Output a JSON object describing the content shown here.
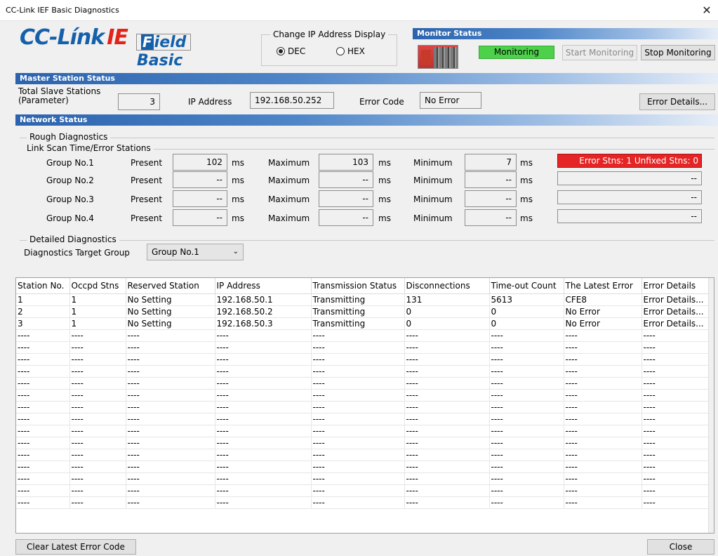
{
  "window": {
    "title": "CC-Link IEF Basic Diagnostics",
    "close_glyph": "✕"
  },
  "logo": {
    "cc": "CC-Línk",
    "ie": "IE",
    "field_initial": "F",
    "field_rest": "ield",
    "basic": "Basic"
  },
  "ip_display": {
    "legend": "Change IP Address Display",
    "dec_label": "DEC",
    "hex_label": "HEX",
    "selected": "DEC"
  },
  "monitor": {
    "header": "Monitor Status",
    "status": "Monitoring",
    "start_label": "Start Monitoring",
    "stop_label": "Stop Monitoring",
    "status_color": "#4dd14a"
  },
  "master": {
    "header": "Master Station Status",
    "total_slave_label_1": "Total Slave Stations",
    "total_slave_label_2": "(Parameter)",
    "total_slave_value": "3",
    "ip_label": "IP Address",
    "ip_value": "192.168.50.252",
    "error_code_label": "Error Code",
    "error_code_value": "No Error",
    "error_details_label": "Error Details..."
  },
  "network": {
    "header": "Network Status",
    "rough_title": "Rough Diagnostics",
    "link_scan_title": "Link Scan Time/Error Stations",
    "present_label": "Present",
    "maximum_label": "Maximum",
    "minimum_label": "Minimum",
    "unit": "ms",
    "groups": [
      {
        "name": "Group No.1",
        "present": "102",
        "maximum": "103",
        "minimum": "7",
        "error_text": "Error Stns: 1  Unfixed Stns: 0"
      },
      {
        "name": "Group No.2",
        "present": "--",
        "maximum": "--",
        "minimum": "--",
        "error_text": "--"
      },
      {
        "name": "Group No.3",
        "present": "--",
        "maximum": "--",
        "minimum": "--",
        "error_text": "--"
      },
      {
        "name": "Group No.4",
        "present": "--",
        "maximum": "--",
        "minimum": "--",
        "error_text": "--"
      }
    ],
    "detailed_title": "Detailed Diagnostics",
    "target_group_label": "Diagnostics Target Group",
    "target_group_value": "Group No.1",
    "error_color": "#e52525"
  },
  "table": {
    "columns": [
      "Station No.",
      "Occpd Stns",
      "Reserved Station",
      "IP Address",
      "Transmission Status",
      "Disconnections",
      "Time-out Count",
      "The Latest Error",
      "Error Details"
    ],
    "rows": [
      [
        "1",
        "1",
        "No Setting",
        "192.168.50.1",
        "Transmitting",
        "131",
        "5613",
        "CFE8",
        "Error Details..."
      ],
      [
        "2",
        "1",
        "No Setting",
        "192.168.50.2",
        "Transmitting",
        "0",
        "0",
        "No Error",
        "Error Details..."
      ],
      [
        "3",
        "1",
        "No Setting",
        "192.168.50.3",
        "Transmitting",
        "0",
        "0",
        "No Error",
        "Error Details..."
      ],
      [
        "----",
        "----",
        "----",
        "----",
        "----",
        "----",
        "----",
        "----",
        "----"
      ],
      [
        "----",
        "----",
        "----",
        "----",
        "----",
        "----",
        "----",
        "----",
        "----"
      ],
      [
        "----",
        "----",
        "----",
        "----",
        "----",
        "----",
        "----",
        "----",
        "----"
      ],
      [
        "----",
        "----",
        "----",
        "----",
        "----",
        "----",
        "----",
        "----",
        "----"
      ],
      [
        "----",
        "----",
        "----",
        "----",
        "----",
        "----",
        "----",
        "----",
        "----"
      ],
      [
        "----",
        "----",
        "----",
        "----",
        "----",
        "----",
        "----",
        "----",
        "----"
      ],
      [
        "----",
        "----",
        "----",
        "----",
        "----",
        "----",
        "----",
        "----",
        "----"
      ],
      [
        "----",
        "----",
        "----",
        "----",
        "----",
        "----",
        "----",
        "----",
        "----"
      ],
      [
        "----",
        "----",
        "----",
        "----",
        "----",
        "----",
        "----",
        "----",
        "----"
      ],
      [
        "----",
        "----",
        "----",
        "----",
        "----",
        "----",
        "----",
        "----",
        "----"
      ],
      [
        "----",
        "----",
        "----",
        "----",
        "----",
        "----",
        "----",
        "----",
        "----"
      ],
      [
        "----",
        "----",
        "----",
        "----",
        "----",
        "----",
        "----",
        "----",
        "----"
      ],
      [
        "----",
        "----",
        "----",
        "----",
        "----",
        "----",
        "----",
        "----",
        "----"
      ],
      [
        "----",
        "----",
        "----",
        "----",
        "----",
        "----",
        "----",
        "----",
        "----"
      ],
      [
        "----",
        "----",
        "----",
        "----",
        "----",
        "----",
        "----",
        "----",
        "----"
      ]
    ]
  },
  "footer": {
    "clear_label": "Clear Latest Error Code",
    "close_label": "Close"
  }
}
